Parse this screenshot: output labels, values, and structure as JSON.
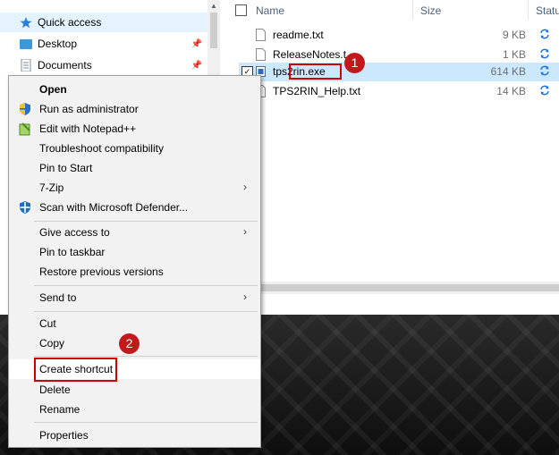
{
  "nav": {
    "quick_access": "Quick access",
    "desktop": "Desktop",
    "documents": "Documents"
  },
  "columns": {
    "name": "Name",
    "size": "Size",
    "status": "Statu"
  },
  "files": [
    {
      "name": "readme.txt",
      "size": "9 KB"
    },
    {
      "name": "ReleaseNotes.t",
      "size": "1 KB"
    },
    {
      "name": "tps2rin.exe",
      "size": "614 KB",
      "selected": true
    },
    {
      "name": "TPS2RIN_Help.txt",
      "size": "14 KB"
    }
  ],
  "callouts": {
    "one": "1",
    "two": "2"
  },
  "menu": {
    "open": "Open",
    "run_admin": "Run as administrator",
    "edit_npp": "Edit with Notepad++",
    "troubleshoot": "Troubleshoot compatibility",
    "pin_start": "Pin to Start",
    "seven_zip": "7-Zip",
    "defender": "Scan with Microsoft Defender...",
    "give_access": "Give access to",
    "pin_taskbar": "Pin to taskbar",
    "restore": "Restore previous versions",
    "send_to": "Send to",
    "cut": "Cut",
    "copy": "Copy",
    "create_shortcut": "Create shortcut",
    "delete": "Delete",
    "rename": "Rename",
    "properties": "Properties"
  },
  "colors": {
    "selection": "#cce8ff",
    "highlight_box": "#d00000",
    "callout": "#c21a1a",
    "menu_bg": "#f2f2f2"
  }
}
